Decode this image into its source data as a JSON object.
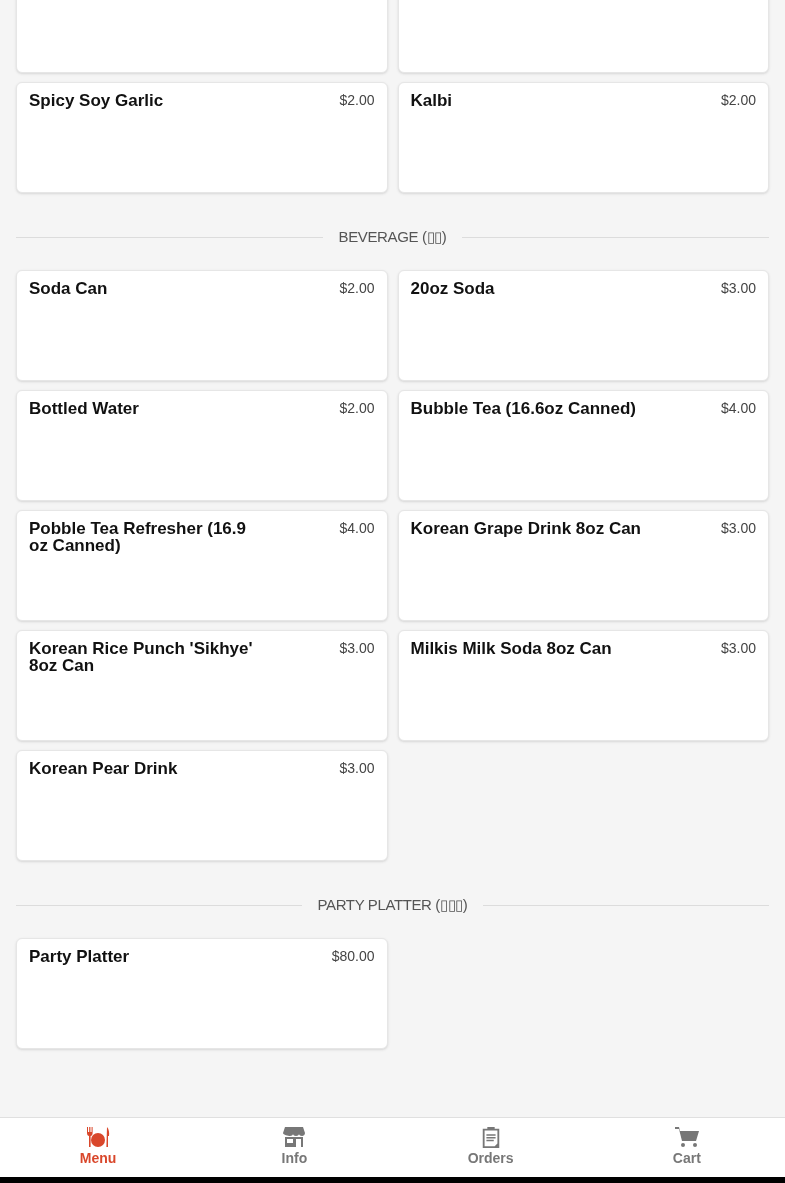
{
  "sections": [
    {
      "items": [
        {
          "kind": "cut_off"
        },
        {
          "kind": "cut_off"
        },
        {
          "kind": "item",
          "name": "Spicy Soy Garlic",
          "price": "$2.00"
        },
        {
          "kind": "item",
          "name": "Kalbi",
          "price": "$2.00"
        }
      ]
    },
    {
      "title": "BEVERAGE (▯▯)",
      "items": [
        {
          "kind": "item",
          "name": "Soda Can",
          "price": "$2.00"
        },
        {
          "kind": "item",
          "name": "20oz Soda",
          "price": "$3.00"
        },
        {
          "kind": "item",
          "name": "Bottled Water",
          "price": "$2.00"
        },
        {
          "kind": "item",
          "name": "Bubble Tea (16.6oz Canned)",
          "price": "$4.00"
        },
        {
          "kind": "item",
          "name": "Pobble Tea Refresher (16.9 oz Canned)",
          "price": "$4.00"
        },
        {
          "kind": "item",
          "name": "Korean Grape Drink 8oz Can",
          "price": "$3.00"
        },
        {
          "kind": "item",
          "name": "Korean Rice Punch 'Sikhye' 8oz Can",
          "price": "$3.00"
        },
        {
          "kind": "item",
          "name": "Milkis Milk Soda 8oz Can",
          "price": "$3.00"
        },
        {
          "kind": "item",
          "name": "Korean Pear Drink",
          "price": "$3.00"
        }
      ]
    },
    {
      "title": "PARTY PLATTER (▯▯▯)",
      "items": [
        {
          "kind": "item",
          "name": "Party Platter",
          "price": "$80.00"
        }
      ]
    }
  ],
  "nav": [
    {
      "kind": "menu",
      "label": "Menu",
      "selected": true
    },
    {
      "kind": "info",
      "label": "Info",
      "selected": false
    },
    {
      "kind": "orders",
      "label": "Orders",
      "selected": false
    },
    {
      "kind": "cart",
      "label": "Cart",
      "selected": false
    }
  ]
}
